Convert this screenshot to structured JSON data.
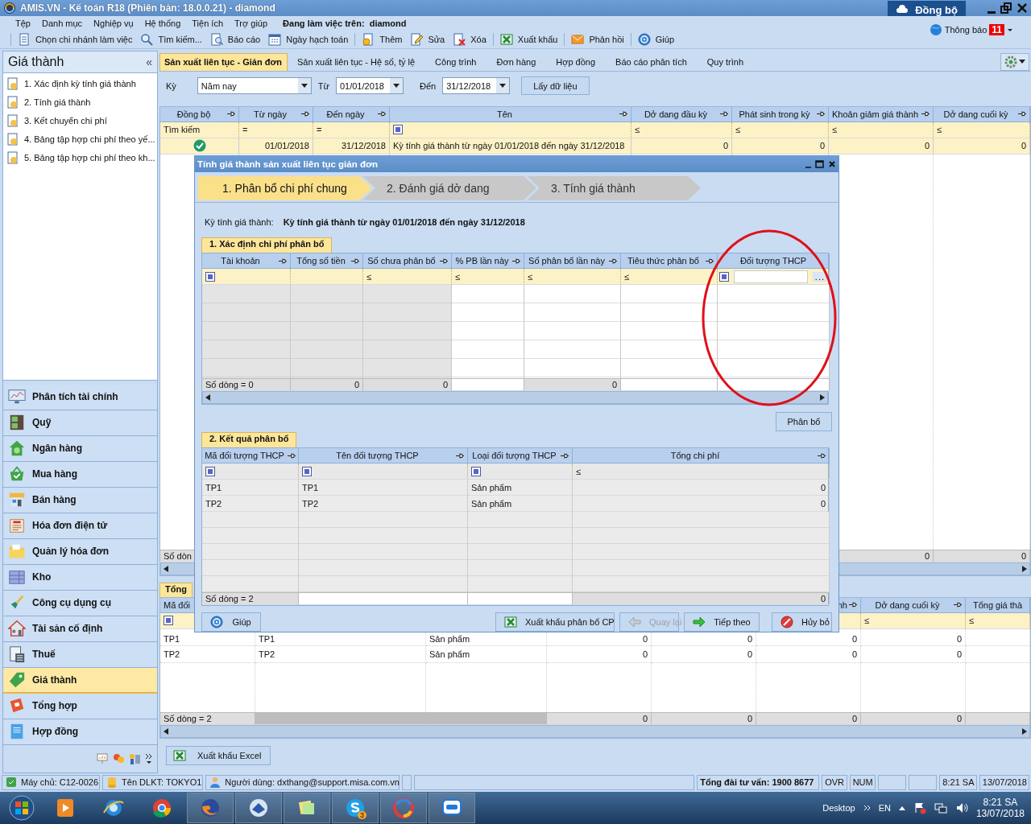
{
  "window": {
    "title": "AMIS.VN - Kế toán R18 (Phiên bản: 18.0.0.21) - diamond",
    "sync_button": "Đồng bộ"
  },
  "menu": [
    "Tệp",
    "Danh mục",
    "Nghiệp vụ",
    "Hệ thống",
    "Tiện ích",
    "Trợ giúp"
  ],
  "working_on": "Đang làm việc trên:  diamond",
  "notifications": {
    "label": "Thông báo",
    "count": "11"
  },
  "toolbar": [
    {
      "kind": "document",
      "label": "Chọn chi nhánh làm việc"
    },
    {
      "kind": "search",
      "label": "Tìm kiếm..."
    },
    {
      "kind": "report",
      "label": "Báo cáo"
    },
    {
      "kind": "calendar",
      "label": "Ngày hạch toán"
    },
    {
      "kind": "add",
      "label": "Thêm"
    },
    {
      "kind": "edit",
      "label": "Sửa"
    },
    {
      "kind": "delete",
      "label": "Xóa"
    },
    {
      "kind": "excel",
      "label": "Xuất khẩu"
    },
    {
      "kind": "mail",
      "label": "Phản hồi"
    },
    {
      "kind": "help",
      "label": "Giúp"
    }
  ],
  "sidebar": {
    "title": "Giá thành",
    "collapse": "«",
    "tasks": [
      "1. Xác định kỳ tính giá thành",
      "2. Tính giá thành",
      "3. Kết chuyển chi phí",
      "4. Bảng tập hợp chi phí theo yế...",
      "5. Bảng tập hợp chi phí theo kh..."
    ],
    "modules": [
      {
        "kind": "analysis",
        "label": "Phân tích tài chính",
        "selected": false
      },
      {
        "kind": "safe",
        "label": "Quỹ",
        "selected": false
      },
      {
        "kind": "bank",
        "label": "Ngân hàng",
        "selected": false
      },
      {
        "kind": "basket",
        "label": "Mua hàng",
        "selected": false
      },
      {
        "kind": "shop",
        "label": "Bán hàng",
        "selected": false
      },
      {
        "kind": "invoice",
        "label": "Hóa đơn điện tử",
        "selected": false
      },
      {
        "kind": "folder",
        "label": "Quản lý hóa đơn",
        "selected": false
      },
      {
        "kind": "warehouse",
        "label": "Kho",
        "selected": false
      },
      {
        "kind": "tool",
        "label": "Công cụ dụng cụ",
        "selected": false
      },
      {
        "kind": "house",
        "label": "Tài sản cố định",
        "selected": false
      },
      {
        "kind": "calculator",
        "label": "Thuế",
        "selected": false
      },
      {
        "kind": "tag",
        "label": "Giá thành",
        "selected": true
      },
      {
        "kind": "book",
        "label": "Tổng hợp",
        "selected": false
      },
      {
        "kind": "contract",
        "label": "Hợp đồng",
        "selected": false
      }
    ]
  },
  "module_tabs": [
    {
      "label": "Sản xuất liên tục - Giản đơn",
      "selected": true
    },
    {
      "label": "Sản xuất liên tục - Hệ số, tỷ lệ",
      "selected": false
    },
    {
      "label": "Công trình",
      "selected": false
    },
    {
      "label": "Đơn hàng",
      "selected": false
    },
    {
      "label": "Hợp đồng",
      "selected": false
    },
    {
      "label": "Báo cáo phân tích",
      "selected": false
    },
    {
      "label": "Quy trình",
      "selected": false
    }
  ],
  "period_filter": {
    "period_label": "Kỳ",
    "period": "Năm nay",
    "from_label": "Từ",
    "from": "01/01/2018",
    "to_label": "Đến",
    "to": "31/12/2018",
    "load_button": "Lấy dữ liệu"
  },
  "periods_table": {
    "columns": [
      {
        "label": "Đồng bộ",
        "pin": true,
        "filter": {
          "kind": "text",
          "text": "Tìm kiếm"
        }
      },
      {
        "label": "Từ ngày",
        "pin": true,
        "filter": {
          "kind": "text",
          "text": "="
        }
      },
      {
        "label": "Đến ngày",
        "pin": true,
        "filter": {
          "kind": "text",
          "text": "="
        }
      },
      {
        "label": "Tên",
        "pin": true,
        "filter": {
          "kind": "checkbox",
          "checked": true
        }
      },
      {
        "label": "Dở dang đầu kỳ",
        "pin": true,
        "filter": {
          "kind": "text",
          "text": "≤"
        }
      },
      {
        "label": "Phát sinh trong kỳ",
        "pin": true,
        "filter": {
          "kind": "text",
          "text": "≤"
        }
      },
      {
        "label": "Khoản giảm giá thành",
        "pin": true,
        "filter": {
          "kind": "text",
          "text": "≤"
        }
      },
      {
        "label": "Dở dang cuối kỳ",
        "pin": true,
        "filter": {
          "kind": "text",
          "text": "≤"
        }
      }
    ],
    "rows": [
      {
        "synced": true,
        "selected": true,
        "cells": [
          "",
          "01/01/2018",
          "31/12/2018",
          "Kỳ tính giá thành từ ngày 01/01/2018 đến ngày 31/12/2018",
          "0",
          "0",
          "0",
          "0"
        ]
      }
    ],
    "footer": {
      "row_count": "Số dòn",
      "column_7": "0",
      "column_8": "0"
    }
  },
  "results_tab": "Tổng",
  "results_table": {
    "columns": {
      "column_1": {
        "label": "Mã đối",
        "pin": false,
        "filter": {
          "kind": "checkbox",
          "checked": true
        }
      },
      "column_6": {
        "label": "nh",
        "pin": true
      },
      "column_7": {
        "label": "Dở dang cuối kỳ",
        "pin": true,
        "filter": {
          "kind": "text",
          "text": "≤"
        }
      },
      "column_8": {
        "label": "Tổng giá thà",
        "pin": false,
        "filter": {
          "kind": "text",
          "text": "≤"
        }
      }
    },
    "rows": [
      [
        "TP1",
        "TP1",
        "Sản phẩm",
        "0",
        "0",
        "0",
        "0"
      ],
      [
        "TP2",
        "TP2",
        "Sản phẩm",
        "0",
        "0",
        "0",
        "0"
      ]
    ],
    "footer": {
      "row_count": "Số dòng = 2",
      "totals": [
        "0",
        "0",
        "0",
        "0"
      ]
    }
  },
  "export_button": "Xuất khẩu Excel",
  "dialog": {
    "title": "Tính giá thành sản xuất liên tục giản đơn",
    "steps": [
      {
        "label": "1. Phân bổ chi phí chung",
        "selected": true
      },
      {
        "label": "2. Đánh giá dở dang",
        "selected": false
      },
      {
        "label": "3. Tính giá thành",
        "selected": false
      }
    ],
    "period_label": "Kỳ tính giá thành:",
    "period": "Kỳ tính giá thành từ ngày 01/01/2018 đến ngày 31/12/2018",
    "allocation": {
      "tab": "1. Xác định chi phí phân bổ",
      "columns": [
        {
          "label": "Tài khoản",
          "pin": true,
          "filter": {
            "kind": "checkbox",
            "checked": true
          }
        },
        {
          "label": "Tổng số tiền",
          "pin": true
        },
        {
          "label": "Số chưa phân bổ",
          "pin": true,
          "filter": {
            "kind": "text",
            "text": "≤"
          }
        },
        {
          "label": "% PB lần này",
          "pin": true,
          "filter": {
            "kind": "text",
            "text": "≤"
          }
        },
        {
          "label": "Số phân bổ lần này",
          "pin": true,
          "filter": {
            "kind": "text",
            "text": "≤"
          }
        },
        {
          "label": "Tiêu thức phân bổ",
          "pin": true,
          "filter": {
            "kind": "text",
            "text": "≤"
          }
        },
        {
          "label": "Đối tượng THCP",
          "pin": false,
          "filter": {
            "kind": "picker",
            "checked": true,
            "button": "..."
          }
        }
      ],
      "footer": {
        "row_count": "Số dòng = 0",
        "column_2": "0",
        "column_3": "0",
        "column_5": "0"
      }
    },
    "allocate_button": "Phân bổ",
    "results": {
      "tab": "2. Kết quả phân bổ",
      "columns": [
        {
          "label": "Mã đối tượng THCP",
          "pin": true,
          "filter": {
            "kind": "checkbox",
            "checked": true
          }
        },
        {
          "label": "Tên đối tượng THCP",
          "pin": true,
          "filter": {
            "kind": "checkbox",
            "checked": true
          }
        },
        {
          "label": "Loại đối tượng THCP",
          "pin": true,
          "filter": {
            "kind": "checkbox",
            "checked": true
          }
        },
        {
          "label": "Tổng chi phí",
          "pin": true,
          "filter": {
            "kind": "text",
            "text": "≤"
          }
        }
      ],
      "rows": [
        [
          "TP1",
          "TP1",
          "Sản phẩm",
          "0"
        ],
        [
          "TP2",
          "TP2",
          "Sản phẩm",
          "0"
        ]
      ],
      "footer": {
        "row_count": "Số dòng = 2",
        "column_4": "0"
      }
    },
    "buttons": [
      {
        "kind": "help",
        "label": "Giúp",
        "disabled": false
      },
      {
        "kind": "excel",
        "label": "Xuất khẩu phân bổ CP",
        "disabled": false
      },
      {
        "kind": "back",
        "label": "Quay lại",
        "disabled": true
      },
      {
        "kind": "next",
        "label": "Tiếp theo",
        "disabled": false
      },
      {
        "kind": "cancel",
        "label": "Hủy bỏ",
        "disabled": false
      }
    ]
  },
  "status_bar": [
    {
      "kind": "server",
      "text": "Máy chủ: C12-0026"
    },
    {
      "kind": "database",
      "text": "Tên DLKT: TOKYO1"
    },
    {
      "kind": "user",
      "text": "Người dùng: dxthang@support.misa.com.vn"
    },
    {
      "kind": "hotline",
      "text": "Tổng đài tư vấn: 1900 8677"
    },
    {
      "kind": "plain",
      "text": "OVR"
    },
    {
      "kind": "plain",
      "text": "NUM"
    },
    {
      "kind": "plain",
      "text": "8:21 SA"
    },
    {
      "kind": "plain",
      "text": "13/07/2018"
    }
  ],
  "taskbar": {
    "apps": [
      {
        "kind": "media"
      },
      {
        "kind": "ie"
      },
      {
        "kind": "chrome"
      },
      {
        "kind": "firefox"
      },
      {
        "kind": "mail"
      },
      {
        "kind": "notes"
      },
      {
        "kind": "skype",
        "badge": "3"
      },
      {
        "kind": "misa"
      },
      {
        "kind": "zalo"
      }
    ],
    "desktop": "Desktop",
    "language": "EN",
    "time": "8:21 SA",
    "date": "13/07/2018"
  }
}
